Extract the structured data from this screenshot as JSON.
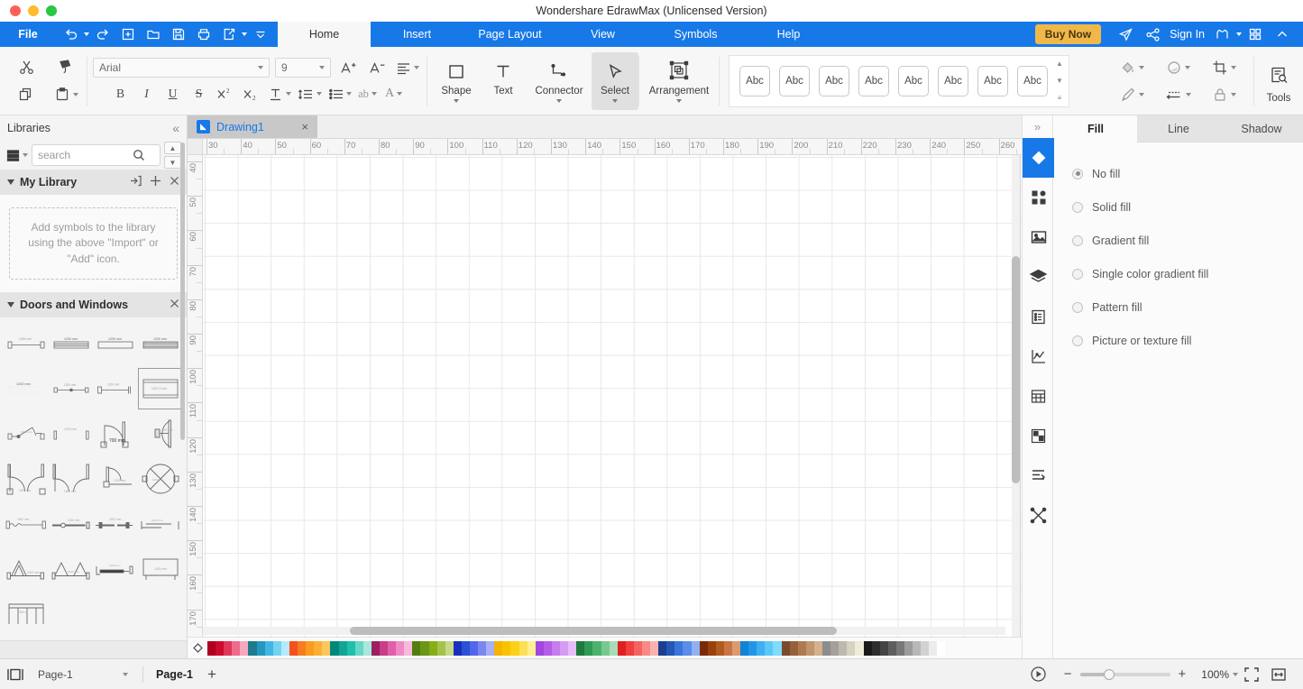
{
  "window": {
    "title": "Wondershare EdrawMax (Unlicensed Version)"
  },
  "menubar": {
    "file_label": "File",
    "quick_access": [
      {
        "name": "undo-icon",
        "has_caret": true
      },
      {
        "name": "redo-icon",
        "has_caret": false
      },
      {
        "name": "new-icon",
        "has_caret": false
      },
      {
        "name": "open-icon",
        "has_caret": false
      },
      {
        "name": "save-icon",
        "has_caret": false
      },
      {
        "name": "print-icon",
        "has_caret": false
      },
      {
        "name": "export-icon",
        "has_caret": true
      },
      {
        "name": "more-commands-icon",
        "has_caret": false
      }
    ],
    "tabs": [
      {
        "label": "Home",
        "active": true
      },
      {
        "label": "Insert",
        "active": false
      },
      {
        "label": "Page Layout",
        "active": false
      },
      {
        "label": "View",
        "active": false
      },
      {
        "label": "Symbols",
        "active": false
      },
      {
        "label": "Help",
        "active": false
      }
    ],
    "buy_now": "Buy Now",
    "sign_in": "Sign In",
    "accent": "#1779e8",
    "buy_now_color": "#f0b849"
  },
  "ribbon": {
    "font_name": "Arial",
    "font_size": "9",
    "grow_font": "A+",
    "shrink_font": "A-",
    "bold": "B",
    "italic": "I",
    "underline": "U",
    "strikethrough": "S",
    "superscript": "X2",
    "subscript": "X2",
    "tools": [
      {
        "label": "Shape",
        "icon": "square-icon",
        "caret": true,
        "active": false
      },
      {
        "label": "Text",
        "icon": "text-icon",
        "caret": false,
        "active": false
      },
      {
        "label": "Connector",
        "icon": "connector-icon",
        "caret": true,
        "active": false
      },
      {
        "label": "Select",
        "icon": "cursor-icon",
        "caret": true,
        "active": true
      }
    ],
    "arrangement_label": "Arrangement",
    "gallery_items": [
      "Abc",
      "Abc",
      "Abc",
      "Abc",
      "Abc",
      "Abc",
      "Abc",
      "Abc"
    ],
    "tools_label": "Tools"
  },
  "libraries": {
    "title": "Libraries",
    "search_placeholder": "search",
    "sections": [
      {
        "title": "My Library",
        "expanded": true,
        "empty_text": "Add symbols to the library using the above \"Import\" or \"Add\" icon."
      },
      {
        "title": "Doors and Windows",
        "expanded": true,
        "shape_count": 25,
        "selected_index": 7
      }
    ]
  },
  "document": {
    "tab_name": "Drawing1",
    "ruler_h_labels": [
      30,
      40,
      50,
      60,
      70,
      80,
      90,
      100,
      110,
      120,
      130,
      140,
      150,
      160,
      170,
      180,
      190,
      200,
      210,
      220,
      230,
      240,
      250,
      260
    ],
    "ruler_v_labels": [
      40,
      50,
      60,
      70,
      80,
      90,
      100,
      110,
      120,
      130,
      140,
      150,
      160,
      170
    ]
  },
  "palette": {
    "colors": [
      "#b00020",
      "#cc0a2e",
      "#e0365a",
      "#ef6b8d",
      "#f6a8bd",
      "#1f7a8c",
      "#2596be",
      "#41b6e6",
      "#74d4f0",
      "#b6e9fa",
      "#f4511e",
      "#f57c1f",
      "#f99c21",
      "#fbb034",
      "#fdc65c",
      "#00897b",
      "#12a594",
      "#1fc0ab",
      "#69d6c4",
      "#a8e7dc",
      "#9c2060",
      "#c73d86",
      "#e05fa8",
      "#ef8bc4",
      "#f8badb",
      "#527d10",
      "#6c9614",
      "#86ae18",
      "#a6c24c",
      "#c8d98a",
      "#1a2fbe",
      "#2a52d8",
      "#5166e8",
      "#7b87ee",
      "#a7b0f4",
      "#f5b400",
      "#f9c300",
      "#fcd117",
      "#fde055",
      "#fff08f",
      "#a246e0",
      "#b45ce8",
      "#c77cee",
      "#d79bf3",
      "#e6bdf8",
      "#1d7a3c",
      "#2f9a54",
      "#4cb26d",
      "#78c98f",
      "#a9dcb6",
      "#e02020",
      "#ef3f3f",
      "#f4635f",
      "#f78a84",
      "#fbb2ad",
      "#1b3f8f",
      "#2557b5",
      "#3a74dd",
      "#5a8ce8",
      "#8fb1f0",
      "#7a2b06",
      "#99410d",
      "#b35a1e",
      "#c97545",
      "#dd9a6e",
      "#0f83d6",
      "#2196e8",
      "#40aef2",
      "#5cc8f7",
      "#7fdcfb",
      "#7b4a2c",
      "#96603b",
      "#ad7a52",
      "#c1956e",
      "#d4b18f",
      "#8d8d8d",
      "#a5a09a",
      "#bdb9ac",
      "#d5d3c2",
      "#eeecd8",
      "#1a1a1a",
      "#2e2e2e",
      "#444444",
      "#5e5e5e",
      "#787878",
      "#9c9c9c",
      "#b8b8b8",
      "#d2d2d2",
      "#ececec",
      "#ffffff"
    ]
  },
  "rail": {
    "collapse_icon": "chevron-double-right-icon",
    "items": [
      {
        "name": "fill-icon",
        "active": true
      },
      {
        "name": "quick-styles-icon",
        "active": false
      },
      {
        "name": "image-icon",
        "active": false
      },
      {
        "name": "layers-icon",
        "active": false
      },
      {
        "name": "notes-icon",
        "active": false
      },
      {
        "name": "chart-icon",
        "active": false
      },
      {
        "name": "table-icon",
        "active": false
      },
      {
        "name": "grouping-icon",
        "active": false
      },
      {
        "name": "align-icon",
        "active": false
      },
      {
        "name": "shuffle-icon",
        "active": false
      }
    ]
  },
  "properties": {
    "tabs": [
      {
        "label": "Fill",
        "active": true
      },
      {
        "label": "Line",
        "active": false
      },
      {
        "label": "Shadow",
        "active": false
      }
    ],
    "fill_options": [
      {
        "label": "No fill",
        "selected": true
      },
      {
        "label": "Solid fill",
        "selected": false
      },
      {
        "label": "Gradient fill",
        "selected": false
      },
      {
        "label": "Single color gradient fill",
        "selected": false
      },
      {
        "label": "Pattern fill",
        "selected": false
      },
      {
        "label": "Picture or texture fill",
        "selected": false
      }
    ]
  },
  "statusbar": {
    "page_select_value": "Page-1",
    "page_tab_label": "Page-1",
    "add_page_label": "+",
    "zoom_value": "100%",
    "zoom_minus": "−",
    "zoom_plus": "+"
  }
}
